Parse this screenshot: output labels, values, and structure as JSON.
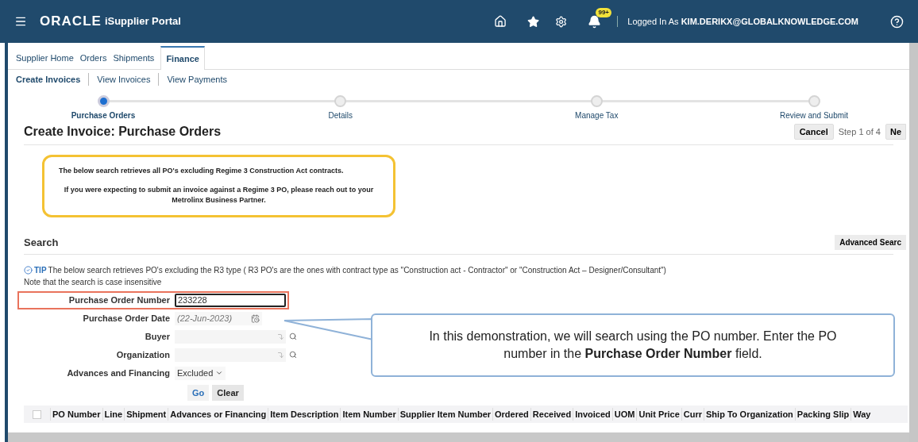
{
  "header": {
    "brand": "ORACLE",
    "product": "iSupplier Portal",
    "notification_count": "99+",
    "user_prefix": "Logged In As",
    "user": "KIM.DERIKX@GLOBALKNOWLEDGE.COM"
  },
  "tabs": [
    {
      "label": "Supplier Home",
      "selected": false
    },
    {
      "label": "Orders",
      "selected": false
    },
    {
      "label": "Shipments",
      "selected": false
    },
    {
      "label": "Finance",
      "selected": true
    }
  ],
  "subtabs": [
    {
      "label": "Create Invoices",
      "selected": true
    },
    {
      "label": "View Invoices",
      "selected": false
    },
    {
      "label": "View Payments",
      "selected": false
    }
  ],
  "steps": [
    {
      "label": "Purchase Orders",
      "selected": true
    },
    {
      "label": "Details",
      "selected": false
    },
    {
      "label": "Manage Tax",
      "selected": false
    },
    {
      "label": "Review and Submit",
      "selected": false
    }
  ],
  "page_title": "Create Invoice: Purchase Orders",
  "actions": {
    "cancel": "Cancel",
    "step": "Step 1 of 4",
    "next": "Ne"
  },
  "notice": [
    "The below search retrieves all PO's excluding Regime 3 Construction Act contracts.",
    "If you were expecting to submit an invoice against a Regime 3 PO, please reach out to your Metrolinx Business Partner."
  ],
  "search": {
    "title": "Search",
    "advanced": "Advanced Searc",
    "tip_label": "TIP",
    "tip_text": "The below search retrieves PO's excluding the R3 type ( R3 PO's are the ones with contract type as \"Construction act - Contractor\" or \"Construction Act – Designer/Consultant\")",
    "note": "Note that the search is case insensitive",
    "fields": [
      {
        "label": "Purchase Order Number",
        "kind": "text",
        "value": "233228",
        "highlighted": true
      },
      {
        "label": "Purchase Order Date",
        "kind": "date",
        "placeholder": "(22-Jun-2023)",
        "highlighted": false
      },
      {
        "label": "Buyer",
        "kind": "lov",
        "highlighted": false
      },
      {
        "label": "Organization",
        "kind": "lov",
        "highlighted": false
      },
      {
        "label": "Advances and Financing",
        "kind": "select",
        "value": "Excluded",
        "highlighted": false
      }
    ],
    "go": "Go",
    "clear": "Clear"
  },
  "callout": "In this demonstration, we will search using the PO number. Enter the PO number in the **Purchase Order Number** field.",
  "table": {
    "select_all_checked": false,
    "columns": [
      "PO Number",
      "Line",
      "Shipment",
      "Advances or Financing",
      "Item Description",
      "Item Number",
      "Supplier Item Number",
      "Ordered",
      "Received",
      "Invoiced",
      "UOM",
      "Unit Price",
      "Curr",
      "Ship To Organization",
      "Packing Slip",
      "Way"
    ]
  }
}
